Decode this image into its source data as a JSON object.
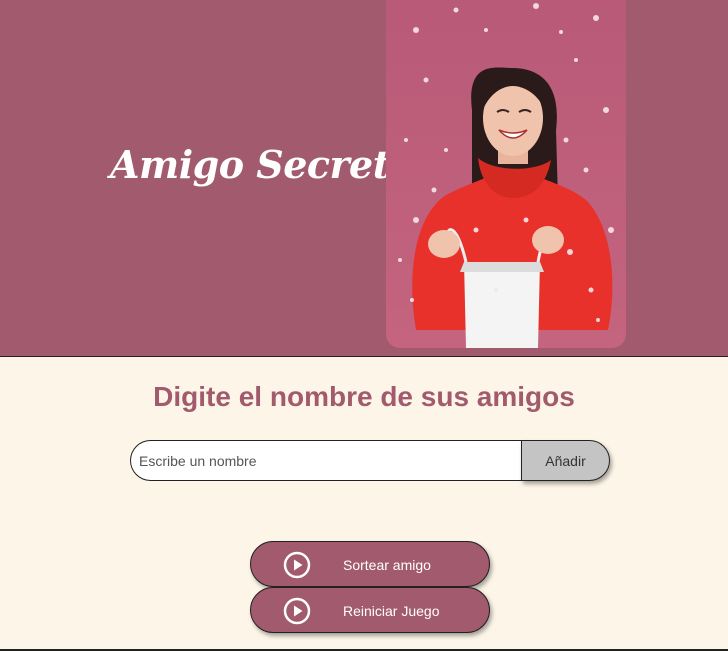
{
  "header": {
    "title": "Amigo Secreto",
    "hero_image_icon": "woman-with-gift-bag-photo"
  },
  "main": {
    "heading": "Digite el nombre de sus amigos",
    "name_input": {
      "placeholder": "Escribe un nombre",
      "value": ""
    },
    "add_button_label": "Añadir",
    "draw_button": {
      "label": "Sortear amigo",
      "icon": "play-circle-icon"
    },
    "reset_button": {
      "label": "Reiniciar Juego",
      "icon": "play-circle-icon"
    }
  },
  "colors": {
    "brand": "#a25a6e",
    "background": "#fdf6e8",
    "add_button": "#c4c4c4",
    "hero_background": "#bd5b7a",
    "sweater": "#e8312a"
  }
}
